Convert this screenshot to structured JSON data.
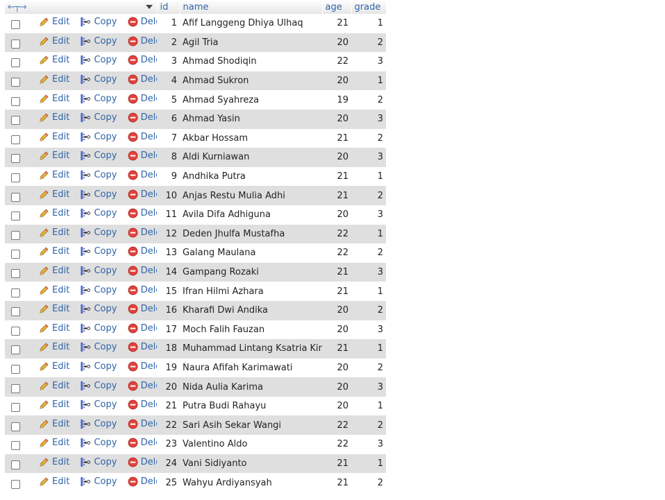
{
  "table": {
    "columns": {
      "id": "id",
      "name": "name",
      "age": "age",
      "grade": "grade"
    },
    "actions": {
      "edit": "Edit",
      "copy": "Copy",
      "delete": "Delete"
    },
    "rows": [
      {
        "id": "1",
        "name": "Afif Langgeng Dhiya Ulhaq",
        "age": "21",
        "grade": "1"
      },
      {
        "id": "2",
        "name": "Agil Tria",
        "age": "20",
        "grade": "2"
      },
      {
        "id": "3",
        "name": "Ahmad Shodiqin",
        "age": "22",
        "grade": "3"
      },
      {
        "id": "4",
        "name": "Ahmad Sukron",
        "age": "20",
        "grade": "1"
      },
      {
        "id": "5",
        "name": "Ahmad Syahreza",
        "age": "19",
        "grade": "2"
      },
      {
        "id": "6",
        "name": "Ahmad Yasin",
        "age": "20",
        "grade": "3"
      },
      {
        "id": "7",
        "name": "Akbar Hossam",
        "age": "21",
        "grade": "2"
      },
      {
        "id": "8",
        "name": "Aldi Kurniawan",
        "age": "20",
        "grade": "3"
      },
      {
        "id": "9",
        "name": "Andhika Putra",
        "age": "21",
        "grade": "1"
      },
      {
        "id": "10",
        "name": "Anjas Restu Mulia Adhi",
        "age": "21",
        "grade": "2"
      },
      {
        "id": "11",
        "name": "Avila Difa Adhiguna",
        "age": "20",
        "grade": "3"
      },
      {
        "id": "12",
        "name": "Deden Jhulfa Mustafha",
        "age": "22",
        "grade": "1"
      },
      {
        "id": "13",
        "name": "Galang Maulana",
        "age": "22",
        "grade": "2"
      },
      {
        "id": "14",
        "name": "Gampang Rozaki",
        "age": "21",
        "grade": "3"
      },
      {
        "id": "15",
        "name": "Ifran Hilmi Azhara",
        "age": "21",
        "grade": "1"
      },
      {
        "id": "16",
        "name": "Kharafi Dwi Andika",
        "age": "20",
        "grade": "2"
      },
      {
        "id": "17",
        "name": "Moch Falih Fauzan",
        "age": "20",
        "grade": "3"
      },
      {
        "id": "18",
        "name": "Muhammad Lintang Ksatria Kinas",
        "age": "21",
        "grade": "1"
      },
      {
        "id": "19",
        "name": "Naura Afifah Karimawati",
        "age": "20",
        "grade": "2"
      },
      {
        "id": "20",
        "name": "Nida Aulia Karima",
        "age": "20",
        "grade": "3"
      },
      {
        "id": "21",
        "name": "Putra Budi Rahayu",
        "age": "20",
        "grade": "1"
      },
      {
        "id": "22",
        "name": "Sari Asih Sekar Wangi",
        "age": "22",
        "grade": "2"
      },
      {
        "id": "23",
        "name": "Valentino Aldo",
        "age": "22",
        "grade": "3"
      },
      {
        "id": "24",
        "name": "Vani Sidiyanto",
        "age": "21",
        "grade": "1"
      },
      {
        "id": "25",
        "name": "Wahyu Ardiyansyah",
        "age": "21",
        "grade": "2"
      }
    ]
  },
  "icons": {
    "header_arrows": "column-resize-arrows-icon",
    "header_dropdown": "dropdown-triangle-icon",
    "edit": "pencil-icon",
    "copy": "copy-insert-icon",
    "delete": "delete-circle-icon"
  },
  "colors": {
    "link": "#2f64a8",
    "row_alt": "#dfdfdf",
    "delete_red": "#d9302c",
    "pencil": "#e0a020"
  }
}
